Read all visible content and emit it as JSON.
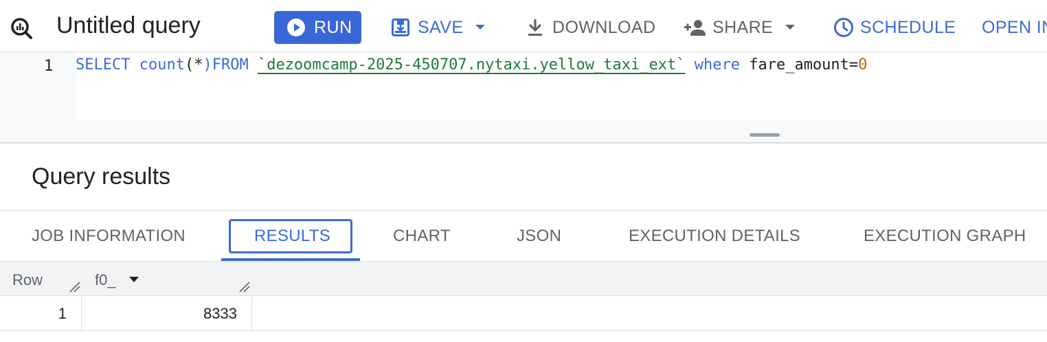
{
  "toolbar": {
    "title": "Untitled query",
    "run_label": "RUN",
    "save_label": "SAVE",
    "download_label": "DOWNLOAD",
    "share_label": "SHARE",
    "schedule_label": "SCHEDULE",
    "open_in_label": "OPEN IN"
  },
  "editor": {
    "line_number": "1",
    "tokens": {
      "select": "SELECT",
      "count": "count",
      "open_paren": "(",
      "star": "*",
      "close_from": ")FROM",
      "table": "`dezoomcamp-2025-450707.nytaxi.yellow_taxi_ext`",
      "where": "where",
      "condition": "fare_amount=",
      "zero": "0"
    }
  },
  "results": {
    "heading": "Query results",
    "tabs": [
      {
        "label": "JOB INFORMATION"
      },
      {
        "label": "RESULTS"
      },
      {
        "label": "CHART"
      },
      {
        "label": "JSON"
      },
      {
        "label": "EXECUTION DETAILS"
      },
      {
        "label": "EXECUTION GRAPH"
      }
    ],
    "active_tab": "RESULTS",
    "table": {
      "columns": [
        "Row",
        "f0_"
      ],
      "rows": [
        {
          "row": "1",
          "f0_": "8333"
        }
      ]
    }
  },
  "colors": {
    "accent": "#3b6bd6",
    "run_button": "#3a67d8",
    "table_ref": "#1e7a35",
    "number_literal": "#b5651d"
  },
  "icons": [
    "bigquery-logo-icon",
    "play-circle-icon",
    "save-icon",
    "chevron-down-icon",
    "download-icon",
    "person-add-icon",
    "clock-icon"
  ]
}
